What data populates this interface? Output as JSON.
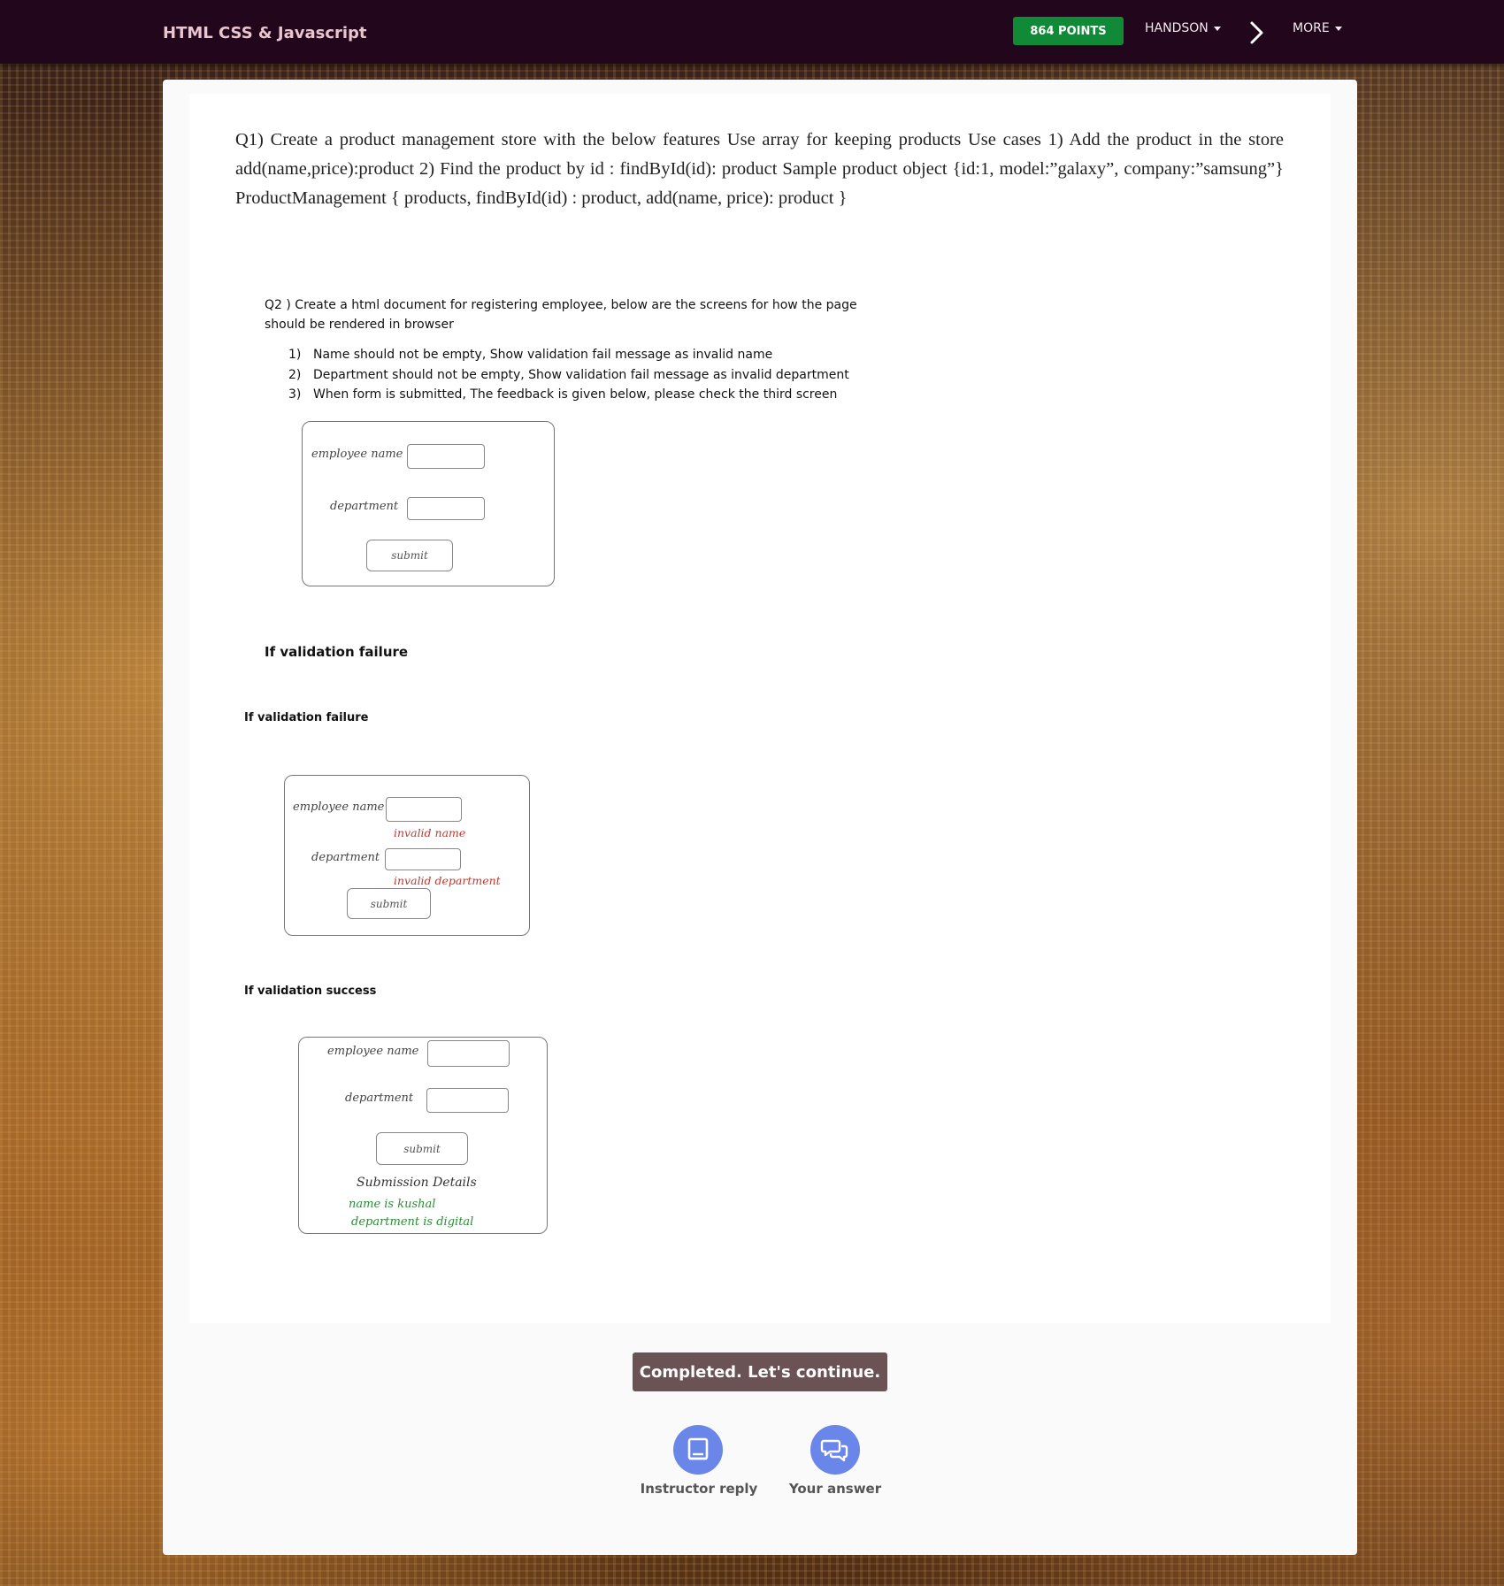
{
  "header": {
    "brand": "HTML CSS & Javascript",
    "points": "864 POINTS",
    "menu_handson": "HANDSON",
    "menu_more": "MORE"
  },
  "content": {
    "q1_text": "Q1) Create a product management store with the below features Use array for keeping products Use cases 1) Add the product in the store add(name,price):product 2) Find the product by id : findById(id): product Sample product object {id:1, model:”galaxy”, company:”samsung”} ProductManagement { products, findById(id) : product, add(name, price): product }",
    "q2_title": "Q2 ) Create a html document for registering employee, below are the screens for how the page should be rendered in browser",
    "q2_items": [
      {
        "num": "1)",
        "text": "Name should not be empty, Show validation fail message as invalid name"
      },
      {
        "num": "2)",
        "text": "Department should not be empty, Show validation fail message as invalid department"
      },
      {
        "num": "3)",
        "text": "When form is submitted, The feedback is given below, please check the third screen"
      }
    ],
    "heading_fail_1": "If validation failure",
    "heading_fail_2": "If validation failure",
    "heading_success": "If validation success",
    "sketch": {
      "employee_name": "employee name",
      "department": "department",
      "submit": "submit",
      "invalid_name": "invalid name",
      "invalid_department": "invalid department",
      "submission_details": "Submission Details",
      "name_result": "name is kushal",
      "department_result": "department is digital"
    }
  },
  "footer": {
    "complete_button": "Completed. Let's continue.",
    "instructor_reply": "Instructor reply",
    "your_answer": "Your answer"
  },
  "colors": {
    "topbar": "#22061c",
    "points_badge": "#118a37",
    "complete_button": "#6b5255",
    "circle_icon": "#6a86e8"
  }
}
